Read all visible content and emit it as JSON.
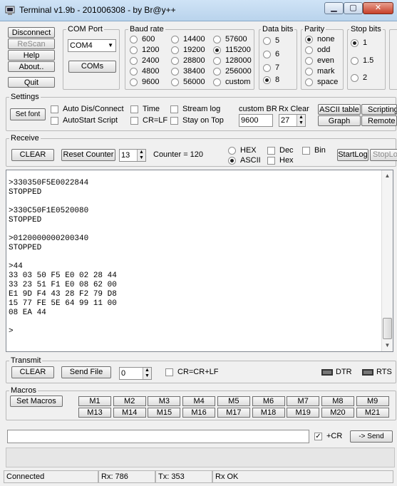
{
  "window": {
    "title": "Terminal v1.9b - 201006308 - by Br@y++",
    "min_glyph": "▁",
    "max_glyph": "▢",
    "close_glyph": "✕"
  },
  "connection": {
    "disconnect": "Disconnect",
    "rescan": "ReScan",
    "help": "Help",
    "about": "About..",
    "quit": "Quit"
  },
  "com_port": {
    "label": "COM Port",
    "value": "COM4",
    "coms_button": "COMs"
  },
  "baud_rate": {
    "label": "Baud rate",
    "options": [
      "600",
      "1200",
      "2400",
      "4800",
      "9600",
      "14400",
      "19200",
      "28800",
      "38400",
      "56000",
      "57600",
      "115200",
      "128000",
      "256000",
      "custom"
    ],
    "selected": "115200"
  },
  "data_bits": {
    "label": "Data bits",
    "options": [
      "5",
      "6",
      "7",
      "8"
    ],
    "selected": "8"
  },
  "parity": {
    "label": "Parity",
    "options": [
      "none",
      "odd",
      "even",
      "mark",
      "space"
    ],
    "selected": "none"
  },
  "stop_bits": {
    "label": "Stop bits",
    "options": [
      "1",
      "1.5",
      "2"
    ],
    "selected": "1"
  },
  "settings": {
    "label": "Settings",
    "set_font": "Set font",
    "auto_dis_connect": "Auto Dis/Connect",
    "autostart_script": "AutoStart Script",
    "time": "Time",
    "cr_lf": "CR=LF",
    "stream_log": "Stream log",
    "stay_on_top": "Stay on Top",
    "custom_br_label": "custom BR",
    "custom_br_value": "9600",
    "rx_clear_label": "Rx Clear",
    "rx_clear_value": "27",
    "ascii_table": "ASCII table",
    "graph": "Graph",
    "scripting": "Scripting",
    "remote": "Remote"
  },
  "receive": {
    "label": "Receive",
    "clear": "CLEAR",
    "reset_counter": "Reset Counter",
    "counter_spin": "13",
    "counter_text": "Counter = 120",
    "hex": "HEX",
    "ascii": "ASCII",
    "mode_selected": "ASCII",
    "dec": "Dec",
    "hex_check": "Hex",
    "bin": "Bin",
    "startlog": "StartLog",
    "stoplog": "StopLog"
  },
  "terminal_lines": [
    ">330350F5E0022844",
    "STOPPED",
    "",
    ">330C50F1E0520080",
    "STOPPED",
    "",
    ">0120000000200340",
    "STOPPED",
    "",
    ">44",
    "33 03 50 F5 E0 02 28 44",
    "33 23 51 F1 E0 08 62 00",
    "E1 9D F4 43 28 F2 79 D8",
    "15 77 FE 5E 64 99 11 00",
    "08 EA 44",
    "",
    ">"
  ],
  "transmit": {
    "label": "Transmit",
    "clear": "CLEAR",
    "send_file": "Send File",
    "spin": "0",
    "cr_crlf": "CR=CR+LF",
    "dtr": "DTR",
    "rts": "RTS"
  },
  "macros": {
    "label": "Macros",
    "set_macros": "Set Macros",
    "row1": [
      "M1",
      "M2",
      "M3",
      "M4",
      "M5",
      "M6",
      "M7",
      "M8",
      "M9"
    ],
    "row2": [
      "M13",
      "M14",
      "M15",
      "M16",
      "M17",
      "M18",
      "M19",
      "M20",
      "M21"
    ]
  },
  "send_bar": {
    "input_value": "",
    "plus_cr": "+CR",
    "send": "-> Send"
  },
  "status": {
    "connection": "Connected",
    "rx": "Rx: 786",
    "tx": "Tx: 353",
    "rx_state": "Rx OK"
  }
}
